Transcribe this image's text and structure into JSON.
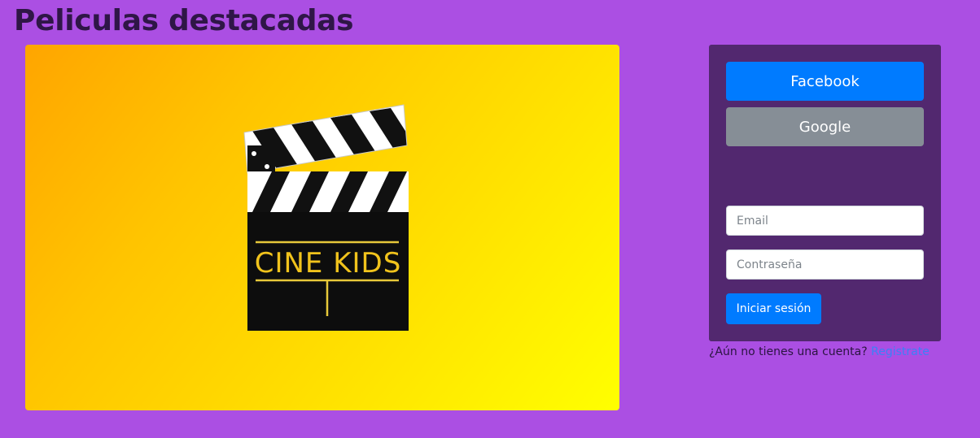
{
  "page": {
    "title": "Peliculas destacadas"
  },
  "hero": {
    "logo_text": "CINE KIDS"
  },
  "login": {
    "facebook_label": "Facebook",
    "google_label": "Google",
    "email_placeholder": "Email",
    "password_placeholder": "Contraseña",
    "submit_label": "Iniciar sesión",
    "signup_prompt": "¿Aún no tienes una cuenta?",
    "signup_link": "Registrate"
  },
  "colors": {
    "background": "#ab4fe3",
    "panel": "#52286f",
    "primary": "#007bff",
    "secondary": "#868e96",
    "gradient_start": "#ffa500",
    "gradient_end": "#ffff00"
  }
}
